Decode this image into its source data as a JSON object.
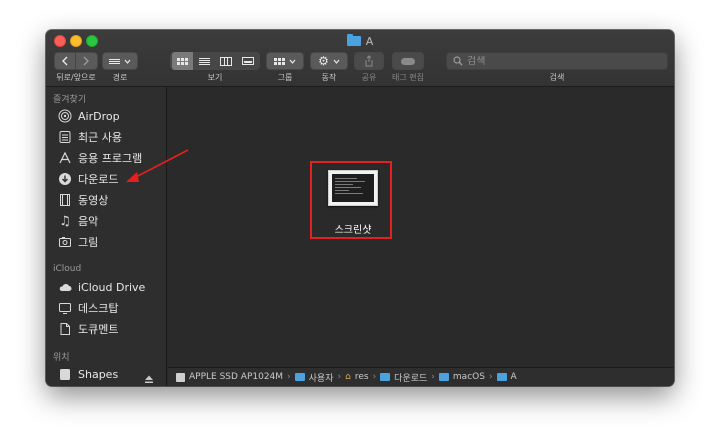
{
  "window": {
    "title": "A"
  },
  "toolbar": {
    "nav_label": "뒤로/앞으로",
    "path_label": "경로",
    "view_label": "보기",
    "group_label": "그룹",
    "action_label": "동작",
    "share_label": "공유",
    "tag_label": "태그 편집",
    "search_label": "검색",
    "search_placeholder": "검색"
  },
  "sidebar": {
    "favorites_title": "즐겨찾기",
    "favorites": [
      {
        "label": "AirDrop",
        "icon": "airdrop-icon"
      },
      {
        "label": "최근 사용",
        "icon": "recents-icon"
      },
      {
        "label": "응용 프로그램",
        "icon": "applications-icon"
      },
      {
        "label": "다운로드",
        "icon": "downloads-icon"
      },
      {
        "label": "동영상",
        "icon": "movies-icon"
      },
      {
        "label": "음악",
        "icon": "music-icon"
      },
      {
        "label": "그림",
        "icon": "pictures-icon"
      }
    ],
    "icloud_title": "iCloud",
    "icloud": [
      {
        "label": "iCloud Drive",
        "icon": "cloud-icon"
      },
      {
        "label": "데스크탑",
        "icon": "desktop-icon"
      },
      {
        "label": "도큐멘트",
        "icon": "documents-icon"
      }
    ],
    "locations_title": "위치",
    "locations": [
      {
        "label": "Shapes",
        "icon": "disk-icon"
      }
    ]
  },
  "content": {
    "files": [
      {
        "name": "스크린샷"
      }
    ]
  },
  "pathbar": {
    "items": [
      "APPLE SSD AP1024M",
      "사용자",
      "res",
      "다운로드",
      "macOS",
      "A"
    ]
  },
  "colors": {
    "annotation_red": "#e5201e",
    "folder_blue": "#4aa3df"
  }
}
